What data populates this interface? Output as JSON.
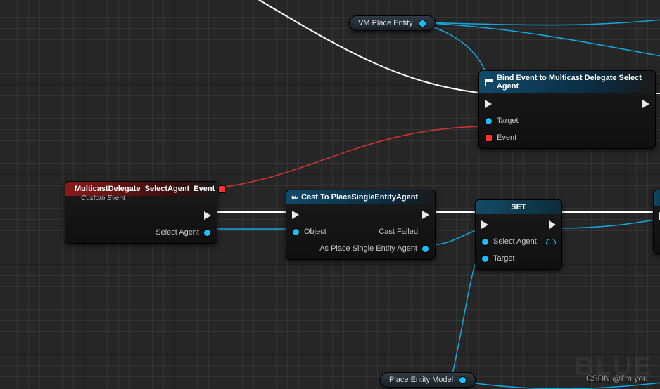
{
  "pills": {
    "vm_place_entity": "VM Place Entity",
    "place_entity_model": "Place Entity Model"
  },
  "bind_node": {
    "title": "Bind Event to Multicast Delegate Select Agent",
    "target": "Target",
    "event": "Event"
  },
  "event_node": {
    "title": "MulticastDelegate_SelectAgent_Event",
    "subtitle": "Custom Event",
    "out_pin": "Select Agent"
  },
  "cast_node": {
    "title": "Cast To PlaceSingleEntityAgent",
    "object": "Object",
    "cast_failed": "Cast Failed",
    "as_out": "As Place Single Entity Agent"
  },
  "set_node": {
    "title": "SET",
    "select_agent": "Select Agent",
    "target": "Target"
  },
  "watermark": "CSDN @I'm you.",
  "watermark2": "BLUE"
}
